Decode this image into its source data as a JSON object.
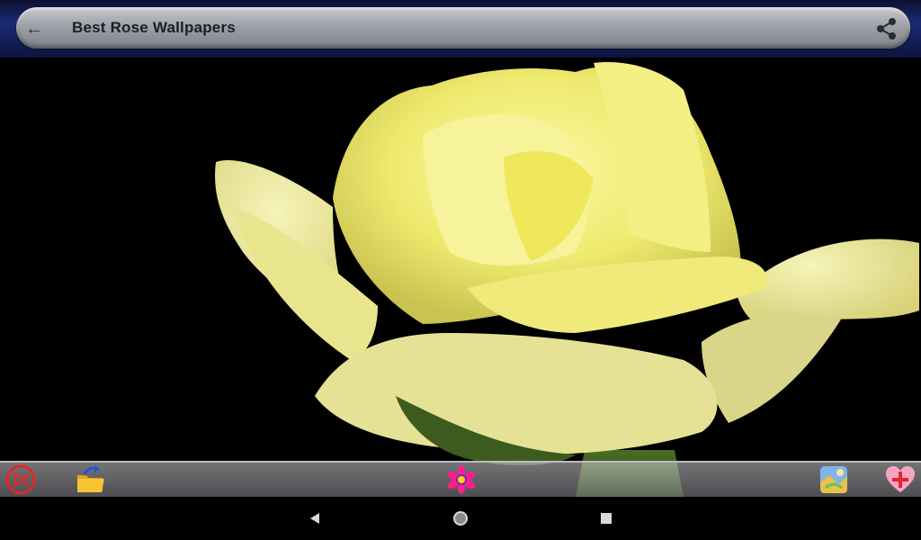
{
  "app": {
    "title": "Best Rose Wallpapers"
  },
  "toolbar": {
    "back_icon": "arrow-left-icon",
    "share_icon": "share-icon"
  },
  "wallpaper": {
    "subject": "yellow-rose",
    "accent": "#f2ef6a"
  },
  "bottom_bar": {
    "icons": [
      "skip-next-icon",
      "folder-icon",
      "flower-icon",
      "gallery-icon",
      "add-favorite-icon"
    ]
  },
  "navigation": {
    "icons": [
      "back-triangle-icon",
      "home-circle-icon",
      "recents-square-icon"
    ]
  }
}
